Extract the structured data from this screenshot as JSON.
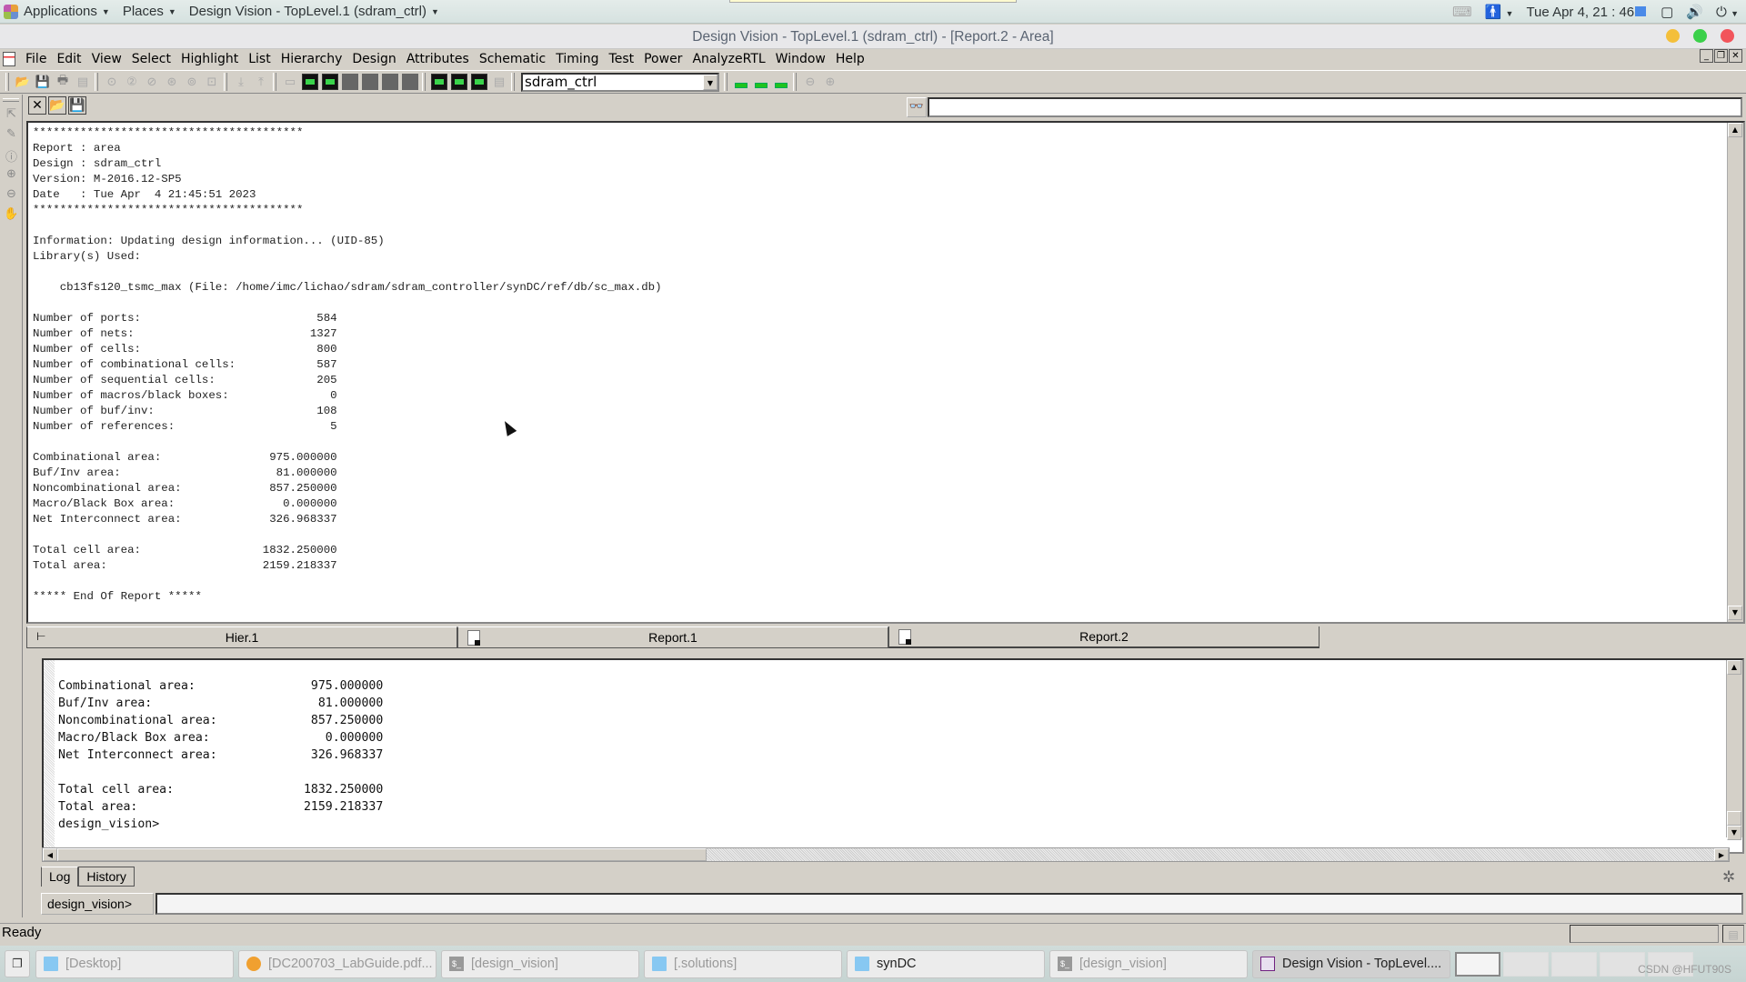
{
  "topbar": {
    "applications": "Applications",
    "places": "Places",
    "active_window": "Design Vision - TopLevel.1 (sdram_ctrl)",
    "clock": "Tue Apr  4, 21 : 46"
  },
  "window": {
    "title": "Design Vision - TopLevel.1 (sdram_ctrl) - [Report.2 - Area]",
    "controls": {
      "minimize_color": "#f4bf3a",
      "maximize_color": "#3bd04a",
      "close_color": "#f2545b"
    }
  },
  "menu": [
    "File",
    "Edit",
    "View",
    "Select",
    "Highlight",
    "List",
    "Hierarchy",
    "Design",
    "Attributes",
    "Schematic",
    "Timing",
    "Test",
    "Power",
    "AnalyzeRTL",
    "Window",
    "Help"
  ],
  "toolbar": {
    "design_select_value": "sdram_ctrl"
  },
  "report": {
    "find_placeholder": "",
    "lines": [
      "****************************************",
      "Report : area",
      "Design : sdram_ctrl",
      "Version: M-2016.12-SP5",
      "Date   : Tue Apr  4 21:45:51 2023",
      "****************************************",
      "",
      "Information: Updating design information... (UID-85)",
      "Library(s) Used:",
      "",
      "    cb13fs120_tsmc_max (File: /home/imc/lichao/sdram/sdram_controller/synDC/ref/db/sc_max.db)",
      "",
      "Number of ports:                          584",
      "Number of nets:                          1327",
      "Number of cells:                          800",
      "Number of combinational cells:            587",
      "Number of sequential cells:               205",
      "Number of macros/black boxes:               0",
      "Number of buf/inv:                        108",
      "Number of references:                       5",
      "",
      "Combinational area:                975.000000",
      "Buf/Inv area:                       81.000000",
      "Noncombinational area:             857.250000",
      "Macro/Black Box area:                0.000000",
      "Net Interconnect area:             326.968337",
      "",
      "Total cell area:                  1832.250000",
      "Total area:                       2159.218337",
      "",
      "***** End Of Report *****"
    ]
  },
  "tabs": [
    {
      "label": "Hier.1",
      "active": false
    },
    {
      "label": "Report.1",
      "active": false
    },
    {
      "label": "Report.2",
      "active": true
    }
  ],
  "console": {
    "lines": [
      "Combinational area:                975.000000",
      "Buf/Inv area:                       81.000000",
      "Noncombinational area:             857.250000",
      "Macro/Black Box area:                0.000000",
      "Net Interconnect area:             326.968337",
      "",
      "Total cell area:                  1832.250000",
      "Total area:                       2159.218337",
      "design_vision>"
    ],
    "log_tab": "Log",
    "history_tab": "History",
    "prompt_label": "design_vision>",
    "command_value": ""
  },
  "status": {
    "text": "Ready"
  },
  "taskbar": {
    "tasks": [
      {
        "label": "[Desktop]",
        "icon": "folder-icon"
      },
      {
        "label": "[DC200703_LabGuide.pdf...",
        "icon": "pdf-icon"
      },
      {
        "label": "[design_vision]",
        "icon": "terminal-icon"
      },
      {
        "label": "[.solutions]",
        "icon": "folder-icon"
      },
      {
        "label": "synDC",
        "icon": "folder-icon"
      },
      {
        "label": "[design_vision]",
        "icon": "terminal-icon"
      },
      {
        "label": "Design Vision - TopLevel....",
        "icon": "design-vision-icon",
        "active": true
      }
    ],
    "watermark": "CSDN @HFUT90S"
  }
}
